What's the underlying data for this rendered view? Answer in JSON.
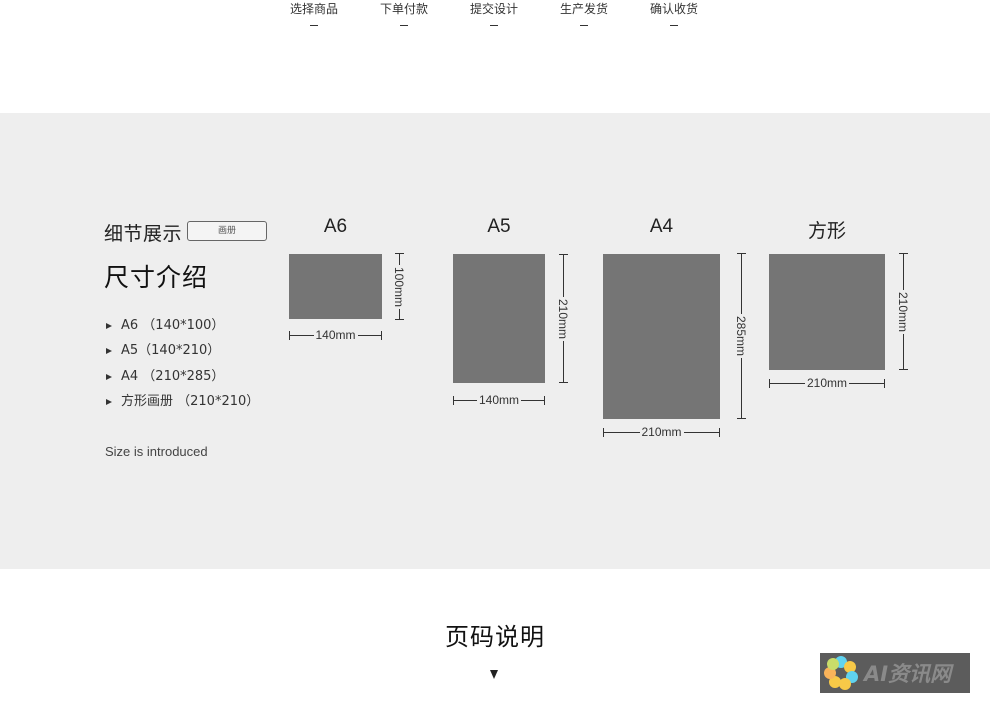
{
  "steps": [
    {
      "label": "选择商品"
    },
    {
      "label": "下单付款"
    },
    {
      "label": "提交设计"
    },
    {
      "label": "生产发货"
    },
    {
      "label": "确认收货"
    }
  ],
  "detail": {
    "title": "细节展示",
    "tag": "画册",
    "size_title": "尺寸介绍",
    "size_list": [
      "A6 （140*100）",
      "A5（140*210）",
      "A4 （210*285）",
      "方形画册 （210*210）"
    ],
    "intro_en": "Size is introduced"
  },
  "cards": [
    {
      "label": "A6",
      "width_label": "140mm",
      "height_label": "100mm",
      "width_mm": 140,
      "height_mm": 100
    },
    {
      "label": "A5",
      "width_label": "140mm",
      "height_label": "210mm",
      "width_mm": 140,
      "height_mm": 210
    },
    {
      "label": "A4",
      "width_label": "210mm",
      "height_label": "285mm",
      "width_mm": 210,
      "height_mm": 285
    },
    {
      "label": "方形",
      "width_label": "210mm",
      "height_label": "210mm",
      "width_mm": 210,
      "height_mm": 210
    }
  ],
  "page_section": {
    "title": "页码说明",
    "arrow_icon": "down-triangle-icon"
  },
  "watermark": {
    "text": "AI资讯网",
    "logo_icon": "flower-logo-icon"
  },
  "colors": {
    "band_bg": "#eeeeee",
    "rect_fill": "#757575",
    "text_dark": "#222222"
  }
}
